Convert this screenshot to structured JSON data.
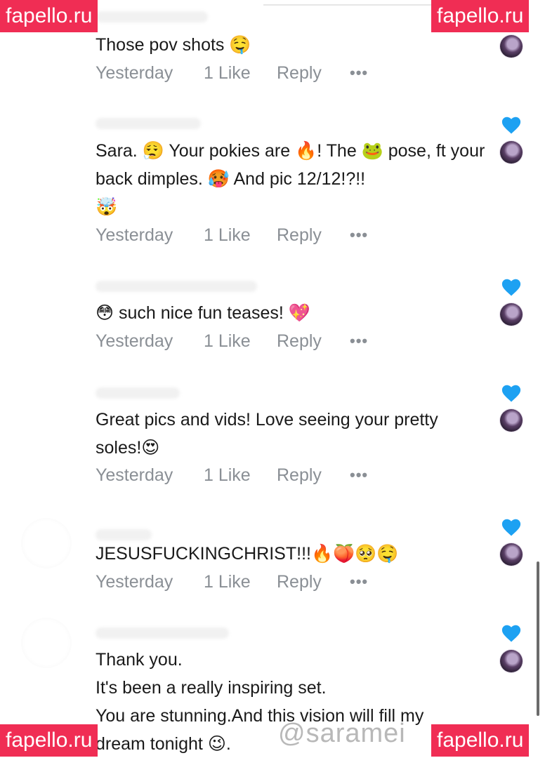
{
  "watermark": {
    "site": "fapello.ru"
  },
  "handle": "@saramei",
  "colors": {
    "heart": "#1da1f2",
    "watermark_bg": "#f02d54",
    "meta_text": "#8a8f95"
  },
  "comments": [
    {
      "text": "Those pov shots 🤤",
      "time": "Yesterday",
      "likes": "1 Like",
      "reply": "Reply",
      "more": "•••",
      "liked": false
    },
    {
      "text": "Sara. 😮‍💨 Your pokies are 🔥! The 🐸 pose, ft your back dimples. 🥵 And pic 12/12!?!!\n🤯",
      "time": "Yesterday",
      "likes": "1 Like",
      "reply": "Reply",
      "more": "•••",
      "liked": true
    },
    {
      "text": "😳 such nice fun teases! 💖",
      "time": "Yesterday",
      "likes": "1 Like",
      "reply": "Reply",
      "more": "•••",
      "liked": true
    },
    {
      "text": "Great pics and vids! Love seeing your pretty soles!😍",
      "time": "Yesterday",
      "likes": "1 Like",
      "reply": "Reply",
      "more": "•••",
      "liked": true
    },
    {
      "text": "JESUSFUCKINGCHRIST!!!🔥🍑🥺🤤",
      "time": "Yesterday",
      "likes": "1 Like",
      "reply": "Reply",
      "more": "•••",
      "liked": true
    },
    {
      "text": "Thank you.\nIt's been a really inspiring set.\nYou are stunning.And this vision will fill my dream tonight 😉.",
      "liked": true
    }
  ]
}
